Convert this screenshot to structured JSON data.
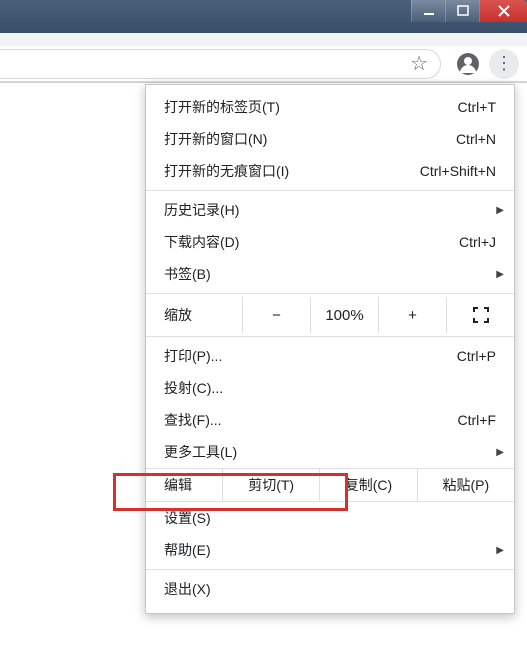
{
  "window": {
    "minimize": "minimize",
    "maximize": "maximize",
    "close": "close"
  },
  "toolbar": {
    "star": "☆",
    "profile": "profile",
    "menu": "⋮"
  },
  "menu": {
    "new_tab": {
      "label": "打开新的标签页(T)",
      "shortcut": "Ctrl+T"
    },
    "new_window": {
      "label": "打开新的窗口(N)",
      "shortcut": "Ctrl+N"
    },
    "incognito": {
      "label": "打开新的无痕窗口(I)",
      "shortcut": "Ctrl+Shift+N"
    },
    "history": {
      "label": "历史记录(H)"
    },
    "downloads": {
      "label": "下载内容(D)",
      "shortcut": "Ctrl+J"
    },
    "bookmarks": {
      "label": "书签(B)"
    },
    "zoom": {
      "label": "缩放",
      "minus": "−",
      "value": "100%",
      "plus": "+"
    },
    "print": {
      "label": "打印(P)...",
      "shortcut": "Ctrl+P"
    },
    "cast": {
      "label": "投射(C)..."
    },
    "find": {
      "label": "查找(F)...",
      "shortcut": "Ctrl+F"
    },
    "more_tools": {
      "label": "更多工具(L)"
    },
    "edit": {
      "label": "编辑",
      "cut": "剪切(T)",
      "copy": "复制(C)",
      "paste": "粘贴(P)"
    },
    "settings": {
      "label": "设置(S)"
    },
    "help": {
      "label": "帮助(E)"
    },
    "exit": {
      "label": "退出(X)"
    }
  }
}
